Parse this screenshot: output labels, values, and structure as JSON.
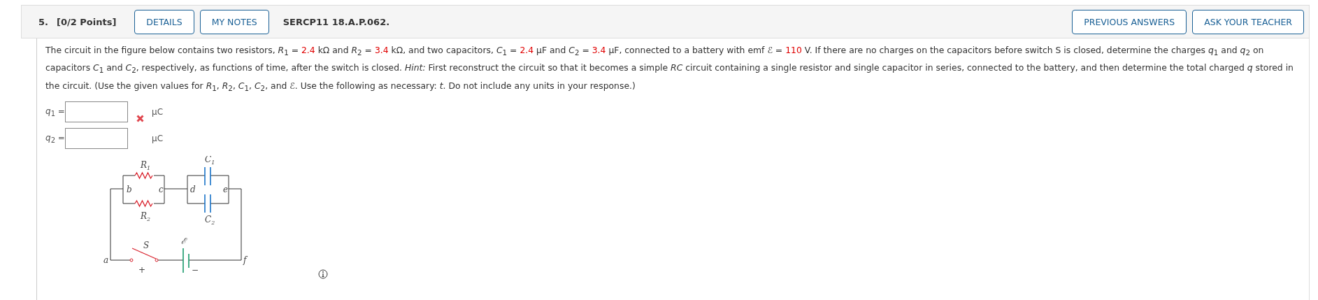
{
  "header": {
    "number": "5.",
    "points": "[0/2 Points]",
    "buttons": [
      {
        "label": "DETAILS"
      },
      {
        "label": "MY NOTES"
      }
    ],
    "code": "SERCP11 18.A.P.062.",
    "right_buttons": [
      {
        "label": "PREVIOUS ANSWERS"
      },
      {
        "label": "ASK YOUR TEACHER"
      }
    ]
  },
  "question": [
    {
      "kind": "text",
      "text": "The circuit in the figure below contains two resistors, *R*$_{1}$ = "
    },
    {
      "kind": "value",
      "text": "2.4"
    },
    {
      "kind": "text",
      "text": " kΩ and *R*$_{2}$ = "
    },
    {
      "kind": "value",
      "text": "3.4"
    },
    {
      "kind": "text",
      "text": " kΩ, and two capacitors, *C*$_{1}$ = "
    },
    {
      "kind": "value",
      "text": "2.4"
    },
    {
      "kind": "text",
      "text": " μF and *C*$_{2}$ = "
    },
    {
      "kind": "value",
      "text": "3.4"
    },
    {
      "kind": "text",
      "text": " μF, connected to a battery with emf ℰ = "
    },
    {
      "kind": "value",
      "text": "110"
    },
    {
      "kind": "text",
      "text": " V. If there are no charges on the capacitors before switch S is closed, determine the charges *q*$_{1}$ and *q*$_{2}$ on capacitors *C*$_{1}$ and *C*$_{2}$, respectively, as functions of time, after the switch is closed. *Hint:* First reconstruct the circuit so that it becomes a simple *RC* circuit containing a single resistor and single capacitor in series, connected to the battery, and then determine the total charged *q* stored in the circuit. (Use the given values for *R*$_{1}$, *R*$_{2}$, *C*$_{1}$, *C*$_{2}$, and ℰ. Use the following as necessary: *t*. Do not include any units in your response.)"
    }
  ],
  "answers": [
    {
      "label": "*q*$_{1}$ =",
      "unit": "μC",
      "incorrect": true
    },
    {
      "label": "*q*$_{2}$ =",
      "unit": "μC",
      "incorrect": false
    }
  ],
  "circuit": {
    "labels": [
      {
        "text": "R",
        "sub": "1"
      },
      {
        "text": "R",
        "sub": "2"
      },
      {
        "text": "C",
        "sub": "1"
      },
      {
        "text": "C",
        "sub": "2"
      },
      {
        "text": "b"
      },
      {
        "text": "c"
      },
      {
        "text": "d"
      },
      {
        "text": "e"
      },
      {
        "text": "a"
      },
      {
        "text": "f"
      },
      {
        "text": "S"
      },
      {
        "text": "ℰ"
      },
      {
        "text": "+"
      },
      {
        "text": "−"
      }
    ]
  }
}
